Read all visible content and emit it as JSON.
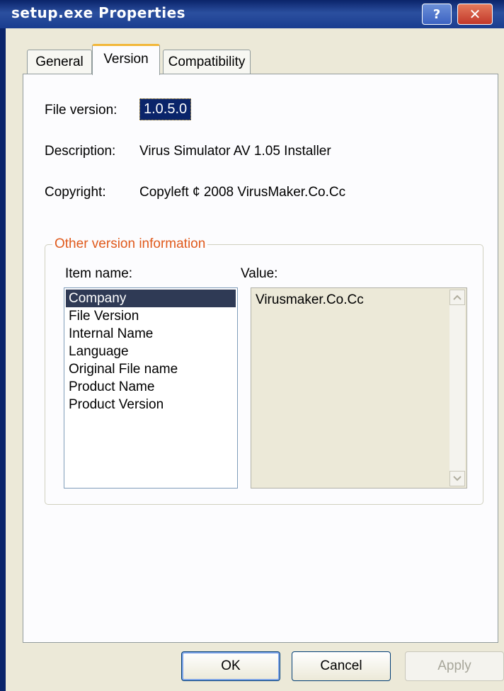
{
  "window": {
    "title": "setup.exe Properties",
    "help_label": "?",
    "close_label": "✕"
  },
  "tabs": [
    {
      "label": "General"
    },
    {
      "label": "Version"
    },
    {
      "label": "Compatibility"
    }
  ],
  "version_tab": {
    "file_version_label": "File version:",
    "file_version_value": "1.0.5.0",
    "description_label": "Description:",
    "description_value": "Virus Simulator AV 1.05 Installer",
    "copyright_label": "Copyright:",
    "copyright_value": "Copyleft ¢ 2008 VirusMaker.Co.Cc"
  },
  "other_info": {
    "group_title": "Other version information",
    "item_name_header": "Item name:",
    "value_header": "Value:",
    "items": [
      {
        "label": "Company"
      },
      {
        "label": "File Version"
      },
      {
        "label": "Internal Name"
      },
      {
        "label": "Language"
      },
      {
        "label": "Original File name"
      },
      {
        "label": "Product Name"
      },
      {
        "label": "Product Version"
      }
    ],
    "selected_item": "Company",
    "selected_value": "Virusmaker.Co.Cc"
  },
  "buttons": {
    "ok": "OK",
    "cancel": "Cancel",
    "apply": "Apply"
  },
  "colors": {
    "title_bar": "#0a246a",
    "group_title": "#e05a1c",
    "tab_highlight": "#f2b738",
    "selection": "#2f3a55"
  },
  "icons": {
    "scroll_up": "chevron-up-icon",
    "scroll_down": "chevron-down-icon"
  }
}
